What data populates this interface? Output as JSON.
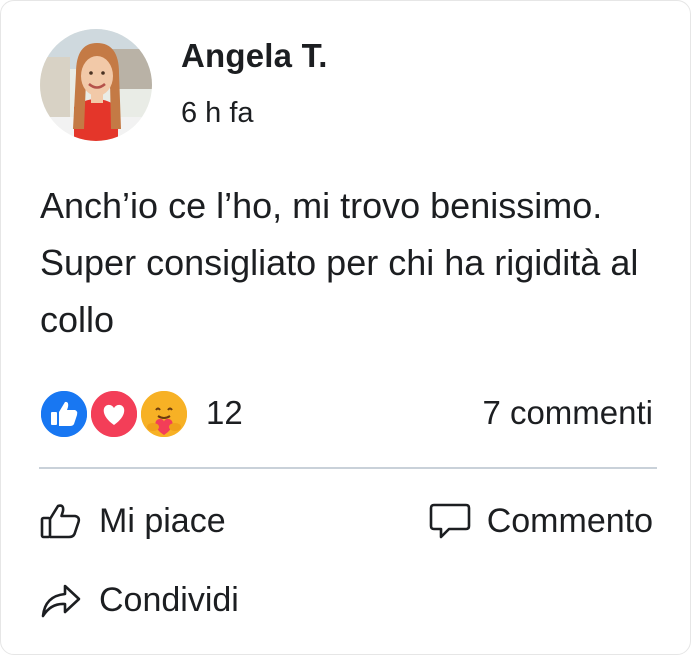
{
  "post": {
    "author": "Angela T.",
    "time": "6 h fa",
    "text": "Anch’io ce l’ho, mi trovo benissimo. Super consigliato per chi ha rigidità al collo"
  },
  "stats": {
    "reaction_icons": [
      "like-icon",
      "love-icon",
      "care-icon"
    ],
    "reaction_count": "12",
    "comments": "7 commenti"
  },
  "actions": {
    "like": "Mi piace",
    "comment": "Commento",
    "share": "Condividi"
  },
  "colors": {
    "like_blue": "#1877f2",
    "love_red": "#f33e58",
    "care_yellow": "#f7b125",
    "divider": "#c9d1d9"
  }
}
